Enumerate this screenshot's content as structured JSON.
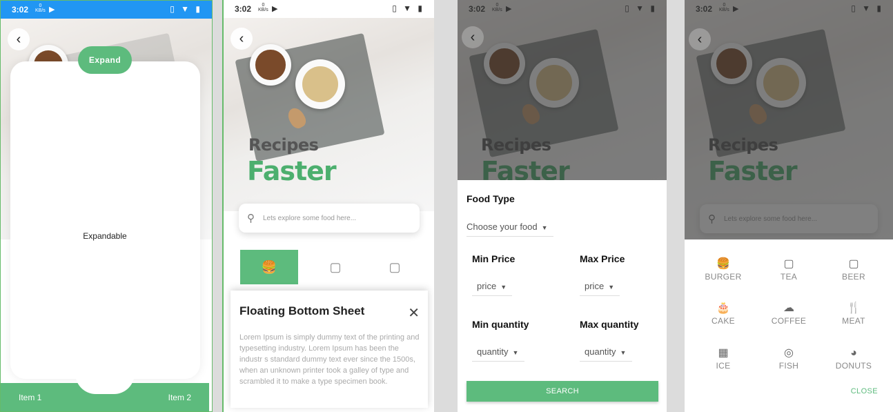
{
  "status_bar": {
    "time": "3:02",
    "kbs_value": "0",
    "kbs_unit": "KB/s"
  },
  "panel1": {
    "expand_button": "Expand",
    "content_label": "Expandable",
    "nav": {
      "item1": "Item 1",
      "item2": "Item 2"
    }
  },
  "hero": {
    "title_line1": "Recipes",
    "title_line2": "Faster"
  },
  "search": {
    "placeholder": "Lets explore some food here..."
  },
  "panel2": {
    "sheet_title": "Floating Bottom Sheet",
    "sheet_body": "Lorem Ipsum is simply dummy text of the printing and typesetting industry. Lorem Ipsum has been the industr s standard dummy text ever since the 1500s, when an unknown printer took a galley of type and scrambled it to make a type specimen book."
  },
  "panel3": {
    "food_type_label": "Food Type",
    "food_type_value": "Choose your food",
    "min_price_label": "Min Price",
    "max_price_label": "Max Price",
    "min_price_value": "price",
    "max_price_value": "price",
    "min_qty_label": "Min quantity",
    "max_qty_label": "Max quantity",
    "min_qty_value": "quantity",
    "max_qty_value": "quantity",
    "search_button": "SEARCH"
  },
  "panel4": {
    "categories": [
      {
        "label": "BURGER",
        "icon": "burger-icon"
      },
      {
        "label": "TEA",
        "icon": "cup-icon"
      },
      {
        "label": "BEER",
        "icon": "cup-icon"
      },
      {
        "label": "CAKE",
        "icon": "cake-icon"
      },
      {
        "label": "COFFEE",
        "icon": "cloud-icon"
      },
      {
        "label": "MEAT",
        "icon": "fork-knife-icon"
      },
      {
        "label": "ICE",
        "icon": "chart-icon"
      },
      {
        "label": "FISH",
        "icon": "target-icon"
      },
      {
        "label": "DONUTS",
        "icon": "pie-icon"
      }
    ],
    "close_button": "CLOSE"
  },
  "colors": {
    "accent": "#5dbb7d",
    "status_bar_blue": "#2196f3"
  }
}
